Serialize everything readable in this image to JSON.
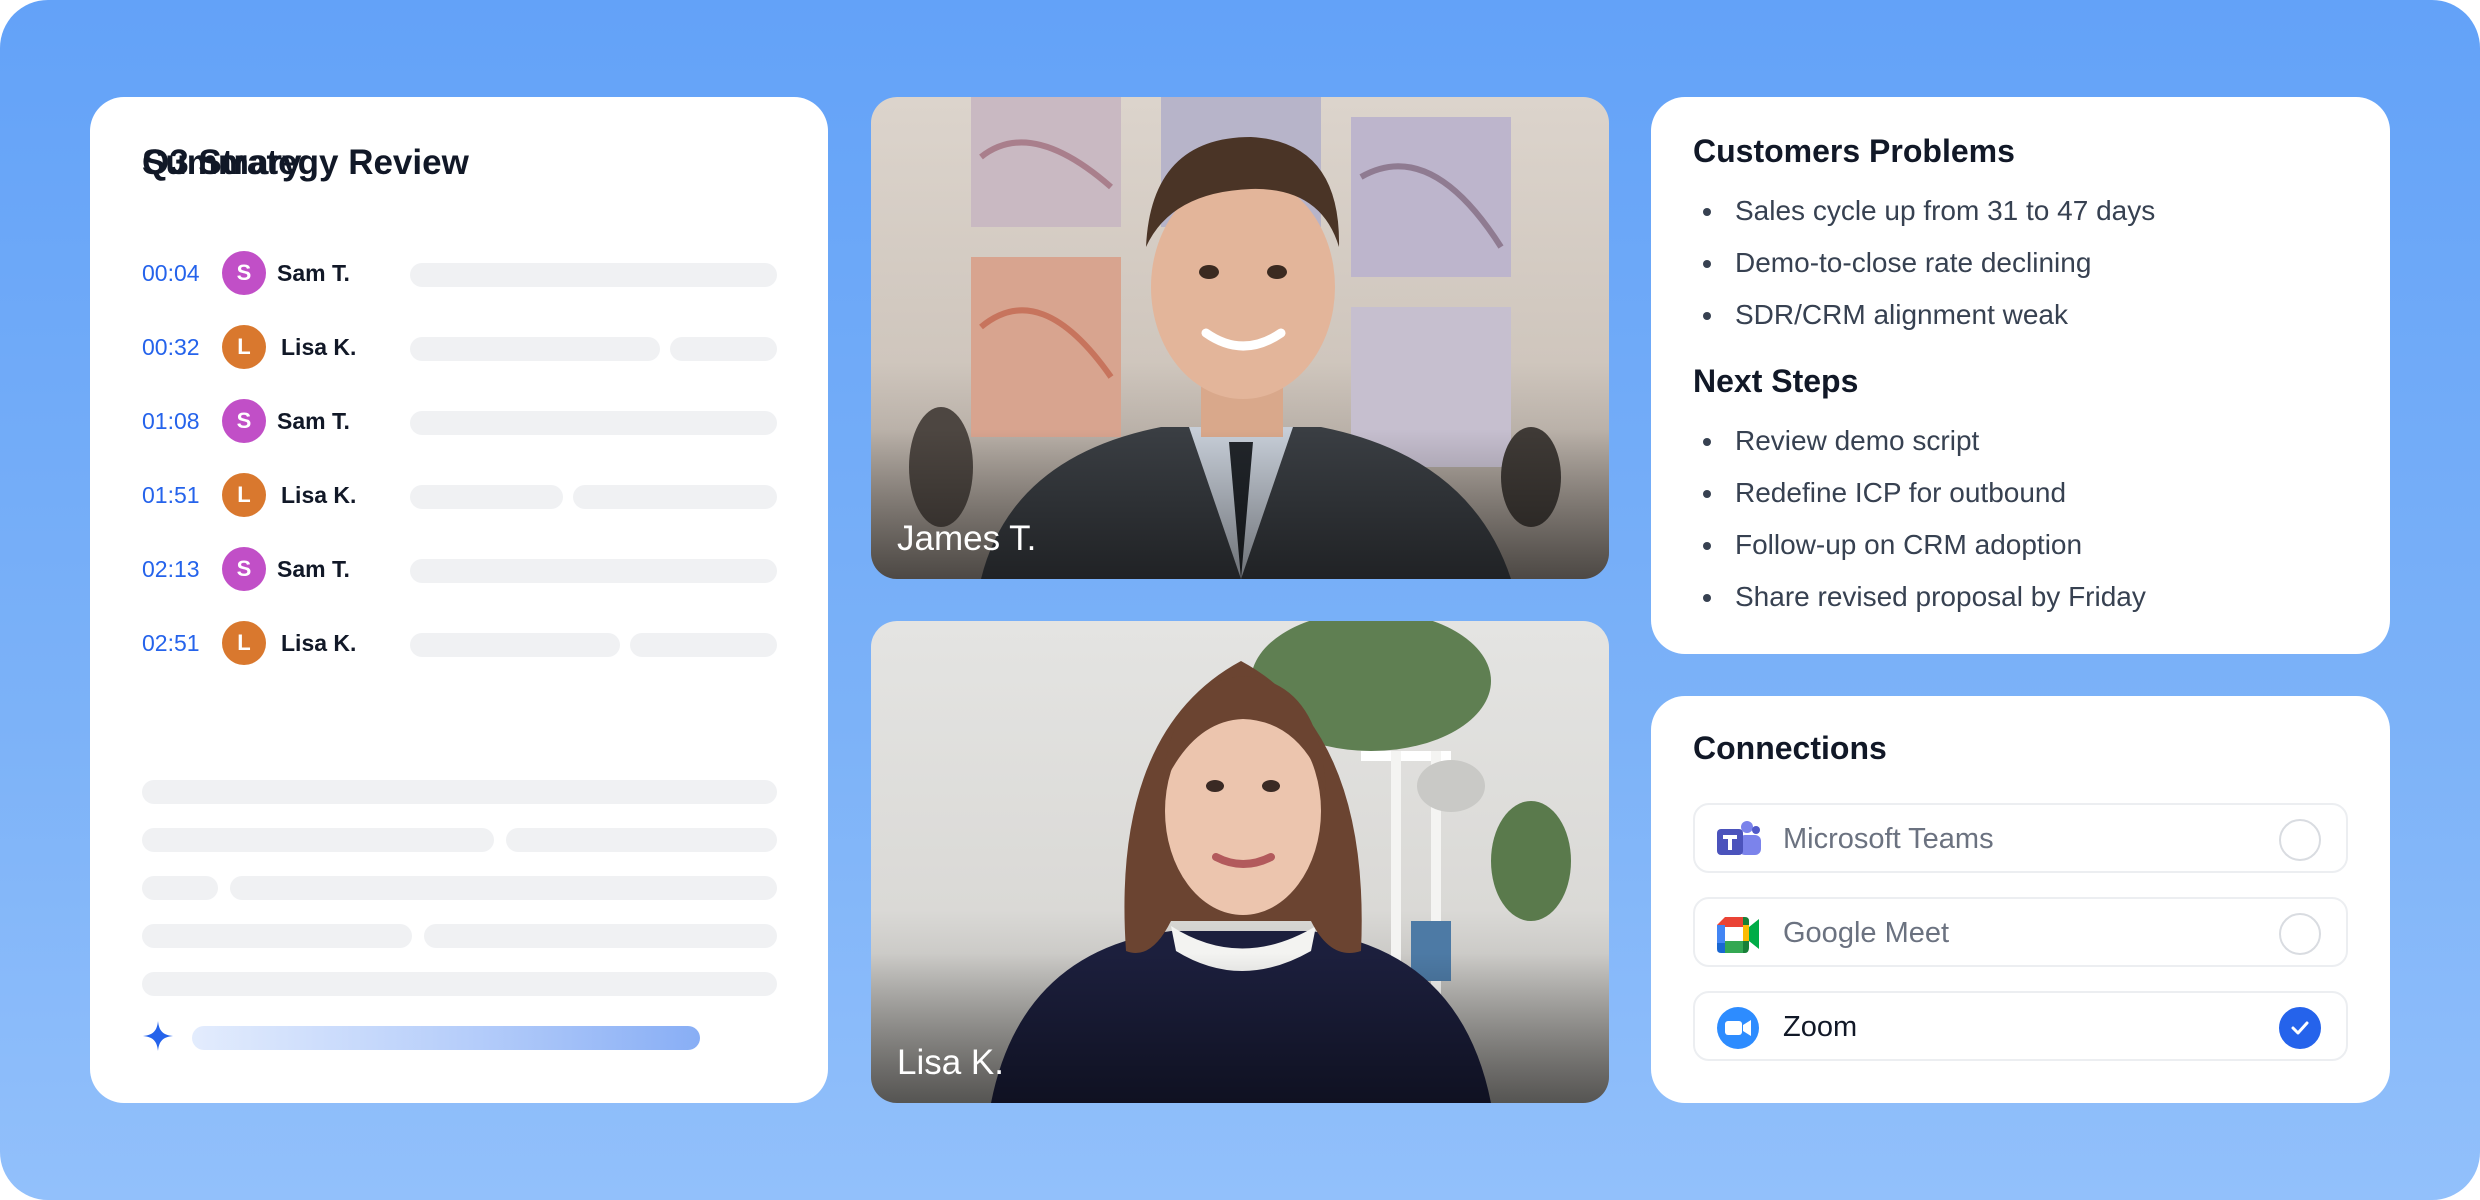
{
  "transcript": {
    "title": "Q3 Strategy Review",
    "entries": [
      {
        "time": "00:04",
        "initial": "S",
        "name": "Sam T."
      },
      {
        "time": "00:32",
        "initial": "L",
        "name": "Lisa K."
      },
      {
        "time": "01:08",
        "initial": "S",
        "name": "Sam T."
      },
      {
        "time": "01:51",
        "initial": "L",
        "name": "Lisa K."
      },
      {
        "time": "02:13",
        "initial": "S",
        "name": "Sam T."
      },
      {
        "time": "02:51",
        "initial": "L",
        "name": "Lisa K."
      }
    ],
    "summary_title": "Summary"
  },
  "videos": [
    {
      "name": "James T."
    },
    {
      "name": "Lisa K."
    }
  ],
  "notes": {
    "problems_title": "Customers Problems",
    "problems": [
      "Sales cycle up from 31 to 47 days",
      "Demo-to-close rate declining",
      "SDR/CRM alignment weak"
    ],
    "steps_title": "Next Steps",
    "steps": [
      "Review demo script",
      "Redefine ICP for outbound",
      "Follow-up on CRM adoption",
      "Share revised proposal by Friday"
    ]
  },
  "connections": {
    "title": "Connections",
    "items": [
      {
        "label": "Microsoft Teams",
        "icon": "microsoft-teams-icon",
        "selected": false
      },
      {
        "label": "Google Meet",
        "icon": "google-meet-icon",
        "selected": false
      },
      {
        "label": "Zoom",
        "icon": "zoom-icon",
        "selected": true
      }
    ]
  },
  "colors": {
    "background": "#63a2f8",
    "accent": "#2563eb",
    "avatar_sam": "#c14fc7",
    "avatar_lisa": "#d9782e"
  }
}
